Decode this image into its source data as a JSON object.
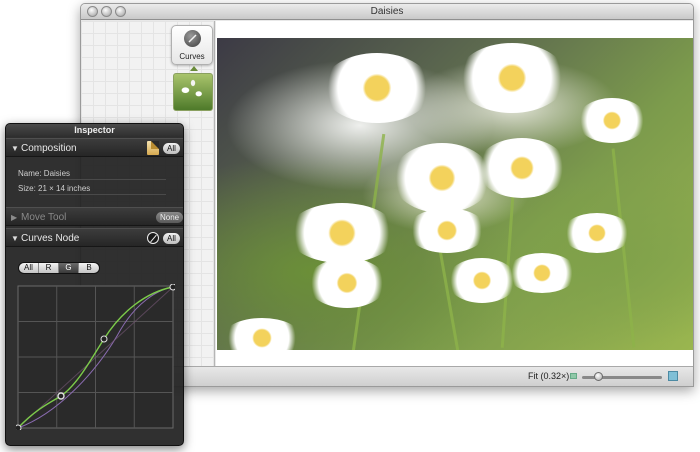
{
  "window": {
    "title": "Daisies"
  },
  "node_tile": {
    "label": "Curves",
    "icon": "curves-node-icon"
  },
  "status": {
    "fit_label": "Fit (0.32×)",
    "zoom_value": 0.2
  },
  "inspector": {
    "title": "Inspector",
    "composition": {
      "title": "Composition",
      "badge": "All",
      "name_row": "Name:  Daisies",
      "size_row": "Size:  21 × 14 inches"
    },
    "move_tool": {
      "title": "Move Tool",
      "badge": "None"
    },
    "curves_node": {
      "title": "Curves Node",
      "badge": "All",
      "channels": [
        "All",
        "R",
        "G",
        "B"
      ],
      "selected_channel": "G"
    }
  },
  "colors": {
    "curve_green": "#7ccb4a",
    "curve_purple": "#8a6bb0",
    "grid": "#555555"
  }
}
